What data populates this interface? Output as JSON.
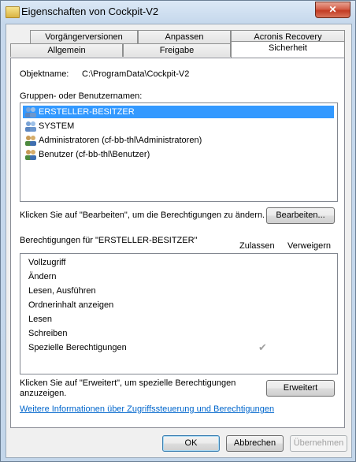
{
  "window": {
    "title": "Eigenschaften von Cockpit-V2",
    "close_label": "✕"
  },
  "tabs": {
    "row1": [
      "Vorgängerversionen",
      "Anpassen",
      "Acronis Recovery"
    ],
    "row2": [
      "Allgemein",
      "Freigabe",
      "Sicherheit"
    ]
  },
  "object": {
    "label": "Objektname:",
    "value": "C:\\ProgramData\\Cockpit-V2"
  },
  "groups": {
    "label": "Gruppen- oder Benutzernamen:",
    "items": [
      "ERSTELLER-BESITZER",
      "SYSTEM",
      "Administratoren (cf-bb-thl\\Administratoren)",
      "Benutzer (cf-bb-thl\\Benutzer)"
    ],
    "selected_index": 0
  },
  "edit": {
    "hint": "Klicken Sie auf \"Bearbeiten\", um die Berechtigungen zu ändern.",
    "button": "Bearbeiten..."
  },
  "permissions": {
    "label": "Berechtigungen für \"ERSTELLER-BESITZER\"",
    "col_allow": "Zulassen",
    "col_deny": "Verweigern",
    "items": [
      "Vollzugriff",
      "Ändern",
      "Lesen, Ausführen",
      "Ordnerinhalt anzeigen",
      "Lesen",
      "Schreiben",
      "Spezielle Berechtigungen"
    ],
    "check_mark": "✔"
  },
  "advanced": {
    "hint_line1": "Klicken Sie auf \"Erweitert\", um spezielle Berechtigungen",
    "hint_line2": "anzuzeigen.",
    "button": "Erweitert"
  },
  "help_link": "Weitere Informationen über Zugriffssteuerung und Berechtigungen",
  "footer": {
    "ok": "OK",
    "cancel": "Abbrechen",
    "apply": "Übernehmen"
  },
  "colors": {
    "selection": "#3399ff",
    "link": "#0066cc"
  }
}
